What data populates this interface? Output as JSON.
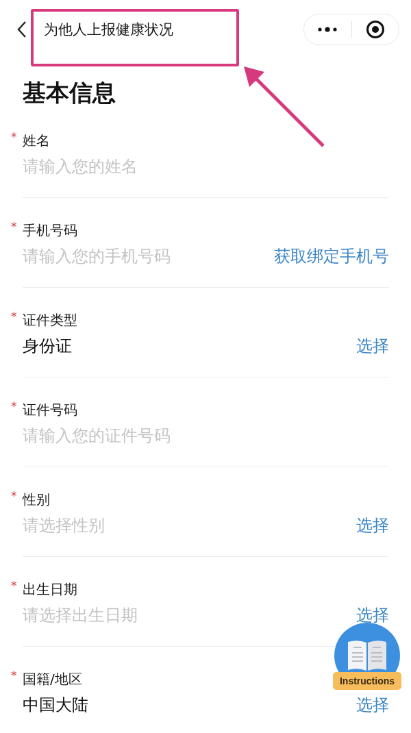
{
  "header": {
    "title": "为他人上报健康状况"
  },
  "section_title": "基本信息",
  "fields": [
    {
      "required_mark": "*",
      "label": "姓名",
      "placeholder": "请输入您的姓名"
    },
    {
      "required_mark": "*",
      "label": "手机号码",
      "placeholder": "请输入您的手机号码",
      "action": "获取绑定手机号"
    },
    {
      "required_mark": "*",
      "label": "证件类型",
      "value": "身份证",
      "action": "选择"
    },
    {
      "required_mark": "*",
      "label": "证件号码",
      "placeholder": "请输入您的证件号码"
    },
    {
      "required_mark": "*",
      "label": "性别",
      "placeholder": "请选择性别",
      "action": "选择"
    },
    {
      "required_mark": "*",
      "label": "出生日期",
      "placeholder": "请选择出生日期",
      "action": "选择"
    },
    {
      "required_mark": "*",
      "label": "国籍/地区",
      "value": "中国大陆",
      "action": "选择"
    }
  ],
  "floating_button": {
    "label": "Instructions"
  }
}
